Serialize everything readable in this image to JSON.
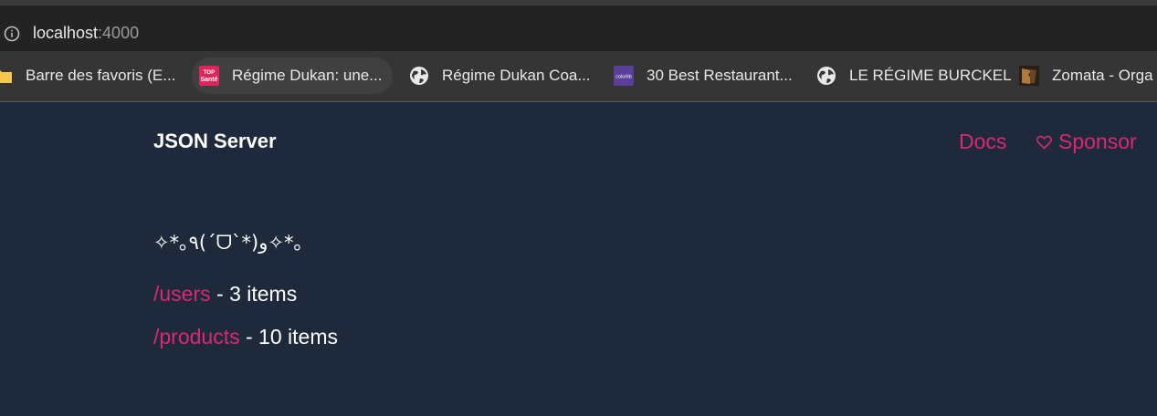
{
  "browser": {
    "url_host": "localhost",
    "url_port": ":4000",
    "bookmarks": [
      {
        "label": "Barre des favoris (E...",
        "icon": "folder-icon"
      },
      {
        "label": "Régime Dukan: une...",
        "icon": "topsante-logo-icon"
      },
      {
        "label": "Régime Dukan Coa...",
        "icon": "globe-icon"
      },
      {
        "label": "30 Best Restaurant...",
        "icon": "colorlib-logo-icon"
      },
      {
        "label": "LE RÉGIME BURCKEL",
        "icon": "globe-icon"
      },
      {
        "label": "Zomata - Orga",
        "icon": "zomata-logo-icon"
      }
    ]
  },
  "header": {
    "brand": "JSON Server",
    "docs_label": "Docs",
    "sponsor_label": "Sponsor"
  },
  "main": {
    "kaomoji": "✧*｡٩(ˊᗜˋ*)و✧*｡",
    "resources": [
      {
        "path": "/users",
        "count_text": " - 3 items"
      },
      {
        "path": "/products",
        "count_text": " - 10 items"
      }
    ]
  },
  "colors": {
    "page_bg": "#1e293b",
    "accent": "#db2777",
    "text": "#ffffff"
  }
}
